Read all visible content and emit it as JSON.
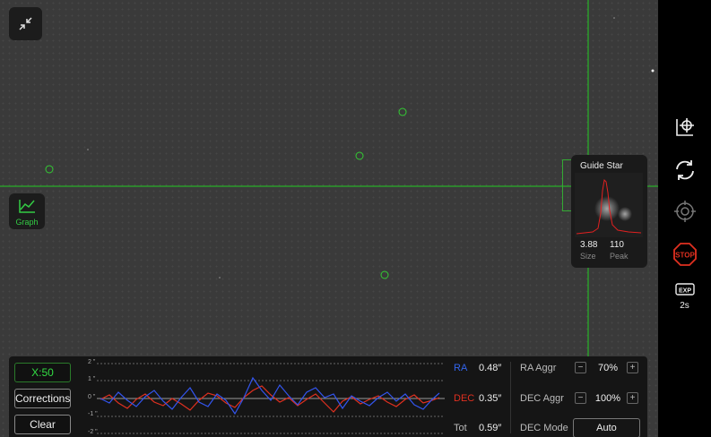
{
  "colors": {
    "accent_green": "#33dd44",
    "ra_blue": "#3355ee",
    "dec_red": "#e03020",
    "stop_red": "#e03020"
  },
  "viewport": {
    "collapse_icon": "collapse-icon",
    "graph_button": {
      "label": "Graph",
      "icon": "line-graph-icon"
    }
  },
  "guide_star": {
    "title": "Guide Star",
    "size_value": "3.88",
    "size_label": "Size",
    "peak_value": "110",
    "peak_label": "Peak"
  },
  "sidebar": {
    "items": [
      {
        "icon": "star-select-icon"
      },
      {
        "icon": "loop-icon"
      },
      {
        "icon": "target-icon"
      },
      {
        "icon": "stop-icon",
        "label": "STOP"
      },
      {
        "icon": "exposure-icon",
        "label": "EXP",
        "value": "2s"
      }
    ]
  },
  "panel": {
    "scale_button": "X:50",
    "corrections_button": "Corrections",
    "clear_button": "Clear",
    "axis_labels": [
      "2 \"",
      "1 \"",
      "0 \"",
      "-1 \"",
      "-2 \""
    ],
    "stats": {
      "ra_label": "RA",
      "ra_value": "0.48″",
      "dec_label": "DEC",
      "dec_value": "0.35″",
      "tot_label": "Tot",
      "tot_value": "0.59″"
    },
    "controls": {
      "ra_aggr_label": "RA Aggr",
      "ra_aggr_value": "70%",
      "dec_aggr_label": "DEC Aggr",
      "dec_aggr_value": "100%",
      "dec_mode_label": "DEC Mode",
      "dec_mode_value": "Auto",
      "minus": "−",
      "plus": "+"
    }
  }
}
